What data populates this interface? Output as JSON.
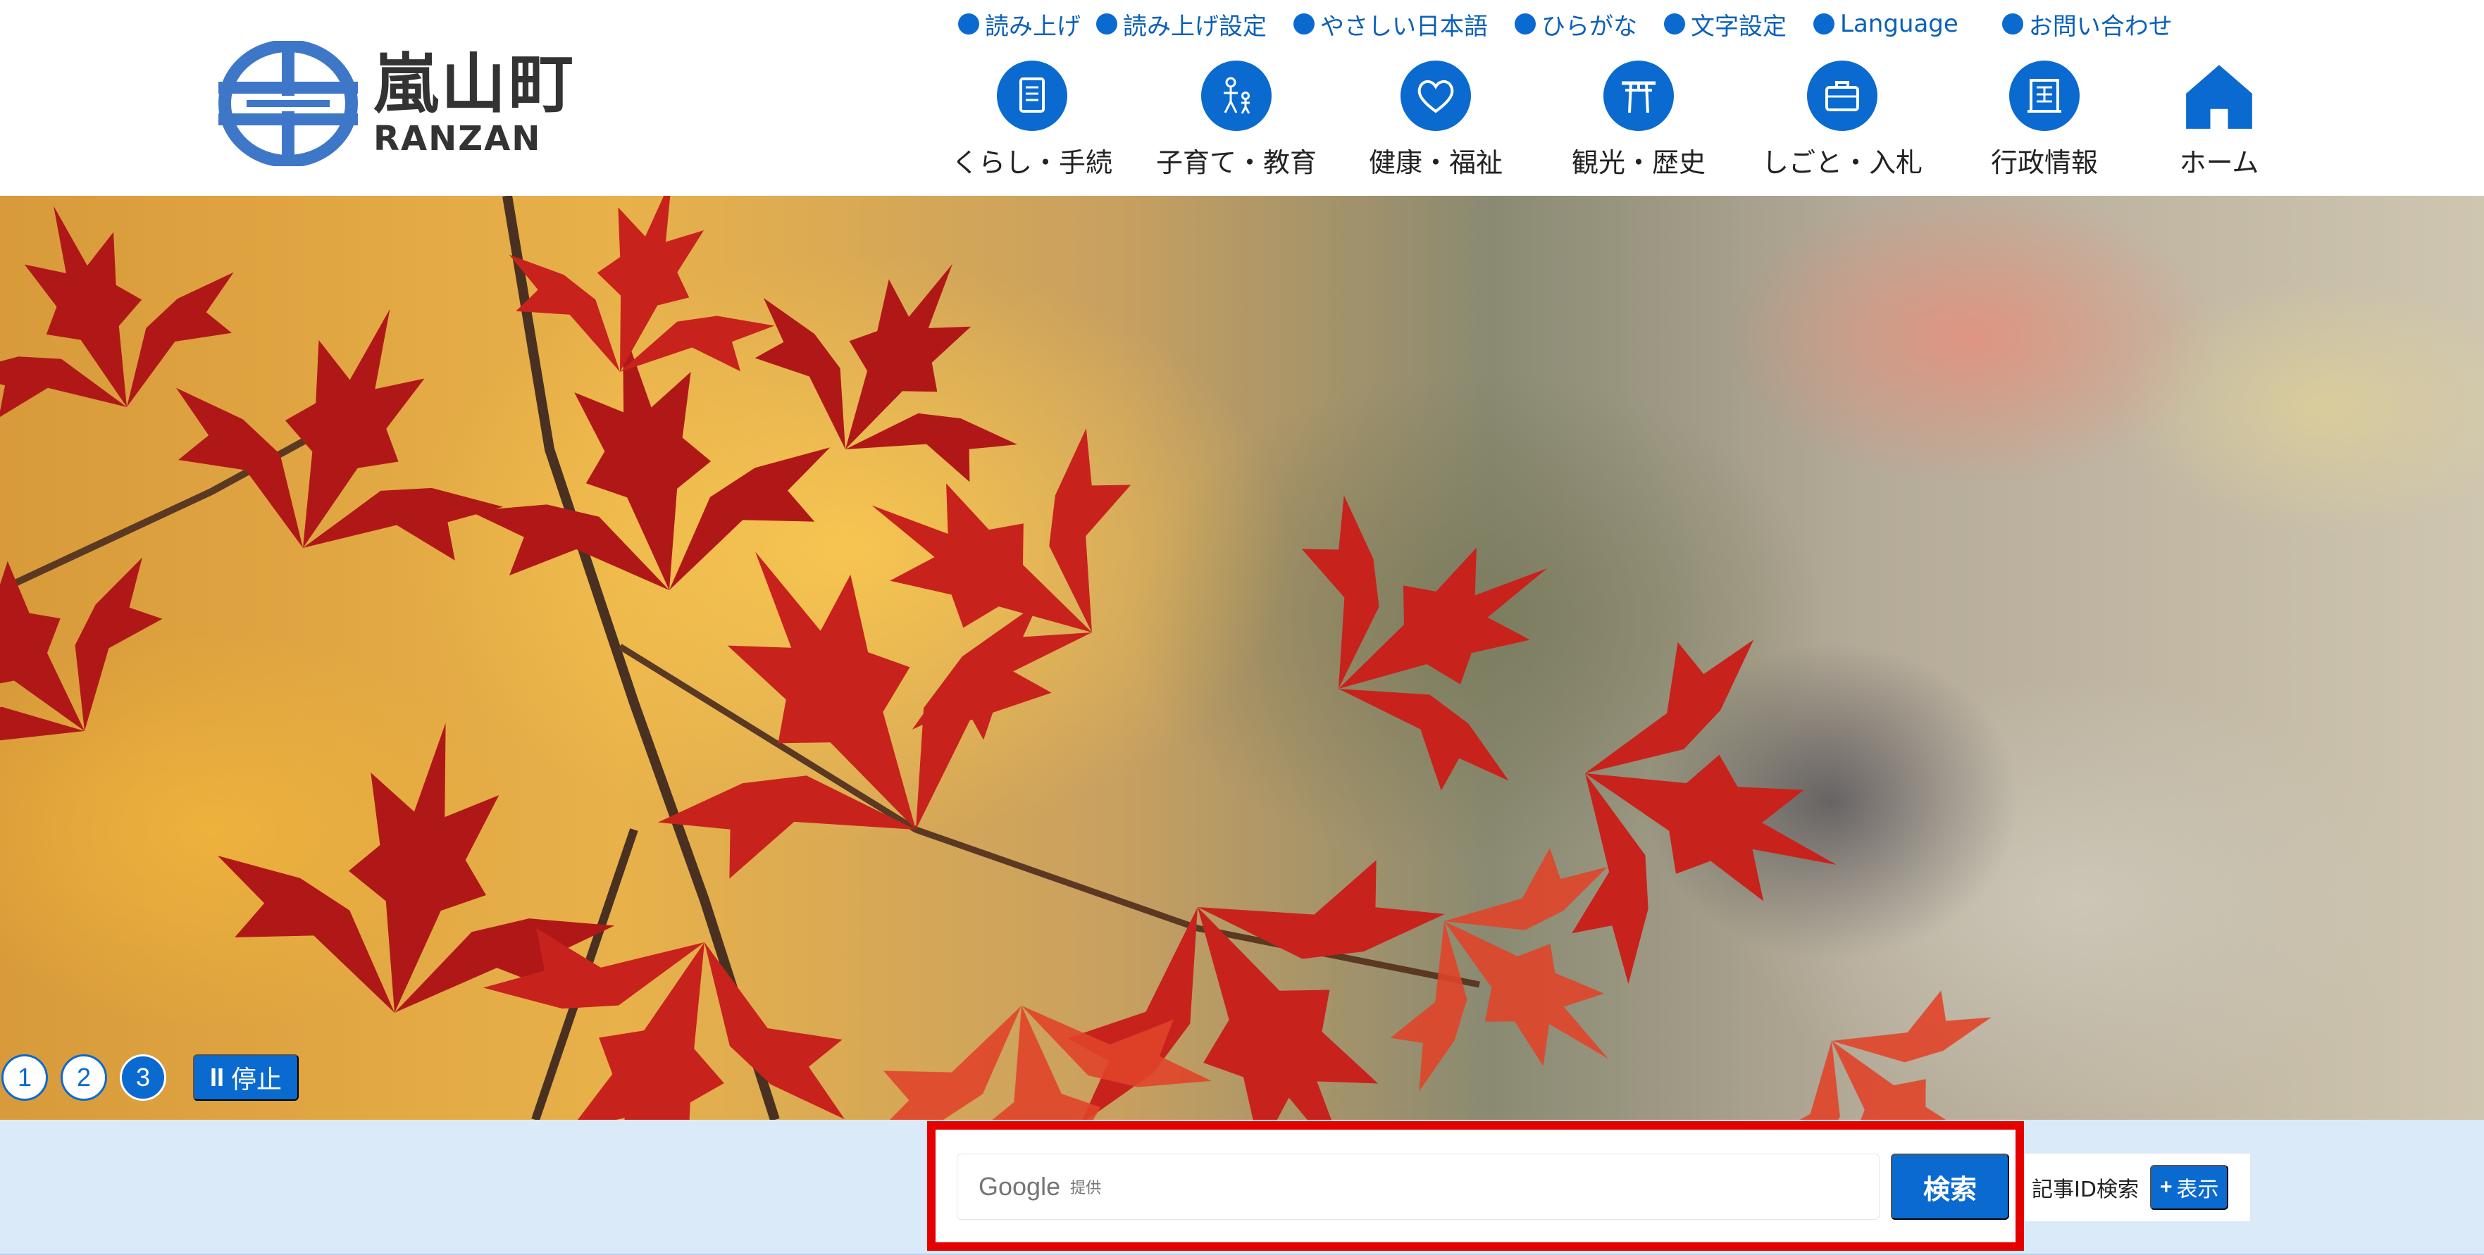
{
  "site": {
    "logo_kanji": "嵐山町",
    "logo_roman": "RANZAN"
  },
  "utility_nav": [
    {
      "label": "読み上げ"
    },
    {
      "label": "読み上げ設定"
    },
    {
      "label": "やさしい日本語"
    },
    {
      "label": "ひらがな"
    },
    {
      "label": "文字設定"
    },
    {
      "label": "Language"
    },
    {
      "label": "お問い合わせ"
    }
  ],
  "global_nav": [
    {
      "label": "くらし・手続",
      "icon": "document-icon"
    },
    {
      "label": "子育て・教育",
      "icon": "parent-child-icon"
    },
    {
      "label": "健康・福祉",
      "icon": "heart-icon"
    },
    {
      "label": "観光・歴史",
      "icon": "torii-gate-icon"
    },
    {
      "label": "しごと・入札",
      "icon": "briefcase-icon"
    },
    {
      "label": "行政情報",
      "icon": "building-icon"
    },
    {
      "label": "ホーム",
      "icon": "home-icon"
    }
  ],
  "slider": {
    "dots": [
      "1",
      "2",
      "3"
    ],
    "active_index": 2,
    "pause_label": "停止",
    "pause_glyph": "II"
  },
  "search": {
    "google_word": "Google",
    "provided_label": "提供",
    "button_label": "検索",
    "highlight_color": "#e50000"
  },
  "article_id_search": {
    "label": "記事ID検索",
    "show_label": "表示",
    "show_glyph": "+"
  },
  "colors": {
    "accent": "#0a6ad0",
    "search_band": "#dbeaf9"
  }
}
